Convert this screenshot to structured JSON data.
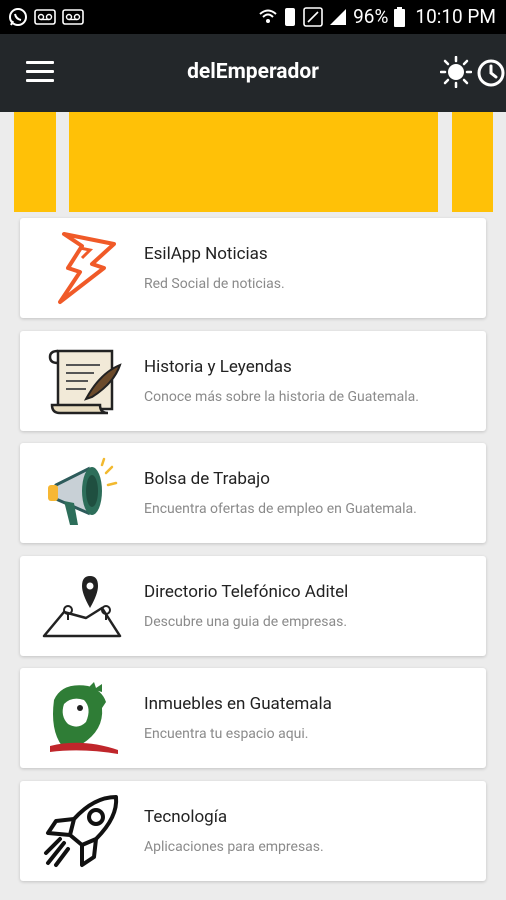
{
  "status_bar": {
    "battery": "96%",
    "time": "10:10 PM",
    "icons": [
      "whatsapp-icon",
      "voicemail-icon",
      "voicemail-icon",
      "wifi-icon",
      "vibrate-icon",
      "nfc-icon",
      "signal-icon",
      "battery-icon"
    ]
  },
  "app_bar": {
    "title": "delEmperador",
    "menu_icon": "hamburger-menu-icon",
    "actions": [
      "brightness-icon",
      "clock-icon"
    ]
  },
  "banner": {
    "color": "#ffc107"
  },
  "cards": [
    {
      "title": "EsilApp Noticias",
      "subtitle": "Red Social de noticias.",
      "icon": "lightning-bolt-icon"
    },
    {
      "title": "Historia y Leyendas",
      "subtitle": "Conoce más sobre la historia de Guatemala.",
      "icon": "scroll-quill-icon"
    },
    {
      "title": "Bolsa de Trabajo",
      "subtitle": "Encuentra ofertas de empleo en Guatemala.",
      "icon": "megaphone-icon"
    },
    {
      "title": "Directorio Telefónico Aditel",
      "subtitle": "Descubre una guia de empresas.",
      "icon": "map-pins-icon"
    },
    {
      "title": "Inmuebles en Guatemala",
      "subtitle": "Encuentra tu espacio aqui.",
      "icon": "quetzal-bird-icon"
    },
    {
      "title": "Tecnología",
      "subtitle": "Aplicaciones para empresas.",
      "icon": "rocket-icon"
    }
  ]
}
